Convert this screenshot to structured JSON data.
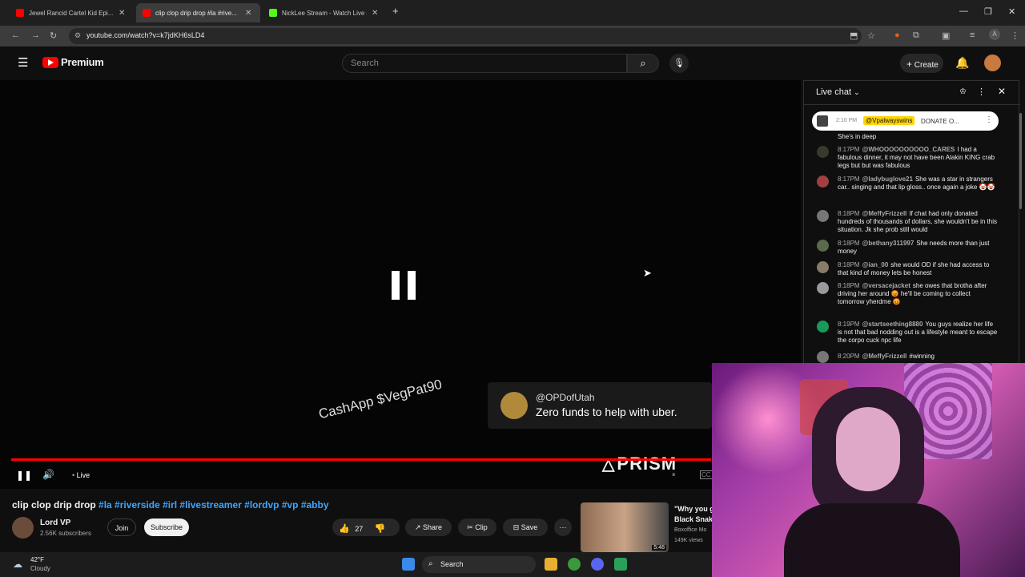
{
  "browser": {
    "tabs": [
      {
        "title": "Jewel Rancid Cartel Kid Epi..."
      },
      {
        "title": "clip clop drip drop #la #rive..."
      },
      {
        "title": "NickLee Stream - Watch Live o..."
      }
    ],
    "url": "youtube.com/watch?v=k7jdKH6sLD4",
    "new_tab": "+",
    "profile_initial": "A"
  },
  "youtube": {
    "logo_text": "Premium",
    "search_placeholder": "Search",
    "create_label": "Create"
  },
  "video": {
    "overlay_cashapp": "CashApp $VegPat90",
    "donation_user": "@OPDofUtah",
    "donation_message": "Zero funds to help with uber.",
    "watermark": "PRISM",
    "live_label": "Live"
  },
  "video_info": {
    "title": "clip clop drip drop",
    "tags": "#la #riverside #irl #livestreamer #lordvp #vp #abby",
    "channel_name": "Lord VP",
    "subscribers": "2.56K subscribers",
    "join_label": "Join",
    "subscribe_label": "Subscribe",
    "likes": "27",
    "share_label": "Share",
    "clip_label": "Clip",
    "save_label": "Save",
    "more_label": "⋯"
  },
  "recommendation": {
    "title_line1": "\"Why you g",
    "title_line2": "Black Snak",
    "channel": "Boxoffice Mo",
    "views": "149K views",
    "duration": "5:48"
  },
  "live_chat": {
    "header": "Live chat",
    "pinned_time": "2:10 PM",
    "pinned_user": "@Vpalwayswins",
    "pinned_text": "DONATE O...",
    "messages": [
      {
        "time": "",
        "user": "",
        "text": "She's in deep"
      },
      {
        "time": "8:17PM",
        "user": "@WHOOOOOOOOOO_CARES",
        "text": "I had a fabulous dinner, it may not have been Alakin KING crab legs but but was fabulous"
      },
      {
        "time": "8:17PM",
        "user": "@ladybuglove21",
        "text": "She was a star in strangers car.. singing and that lip gloss.. once again a joke 🤡🤡"
      },
      {
        "time": "8:18PM",
        "user": "@MeffyFrizzell",
        "text": "If chat had only donated hundreds of thousands of dollars, she wouldn't be in this situation. Jk she prob still would"
      },
      {
        "time": "8:18PM",
        "user": "@bethany311997",
        "text": "She needs more than just money"
      },
      {
        "time": "8:18PM",
        "user": "@ian_00",
        "text": "she would OD if she had access to that kind of money lets be honest"
      },
      {
        "time": "8:18PM",
        "user": "@versacejacket",
        "text": "she owes that brotha after driving her around 😡 he'll be coming to collect tomorrow yherdme 😡"
      },
      {
        "time": "8:19PM",
        "user": "@startseething8880",
        "text": "You guys realize her life is not that bad nodding out is a lifestyle meant to escape the corpo cuck npc life"
      },
      {
        "time": "8:20PM",
        "user": "@MeffyFrizzell",
        "text": "#winning"
      }
    ]
  },
  "taskbar": {
    "temperature": "42°F",
    "weather": "Cloudy",
    "search_label": "Search"
  },
  "colors": {
    "youtube_red": "#ff0000",
    "link_blue": "#3ea6ff",
    "pinned_highlight": "#ffd600"
  }
}
